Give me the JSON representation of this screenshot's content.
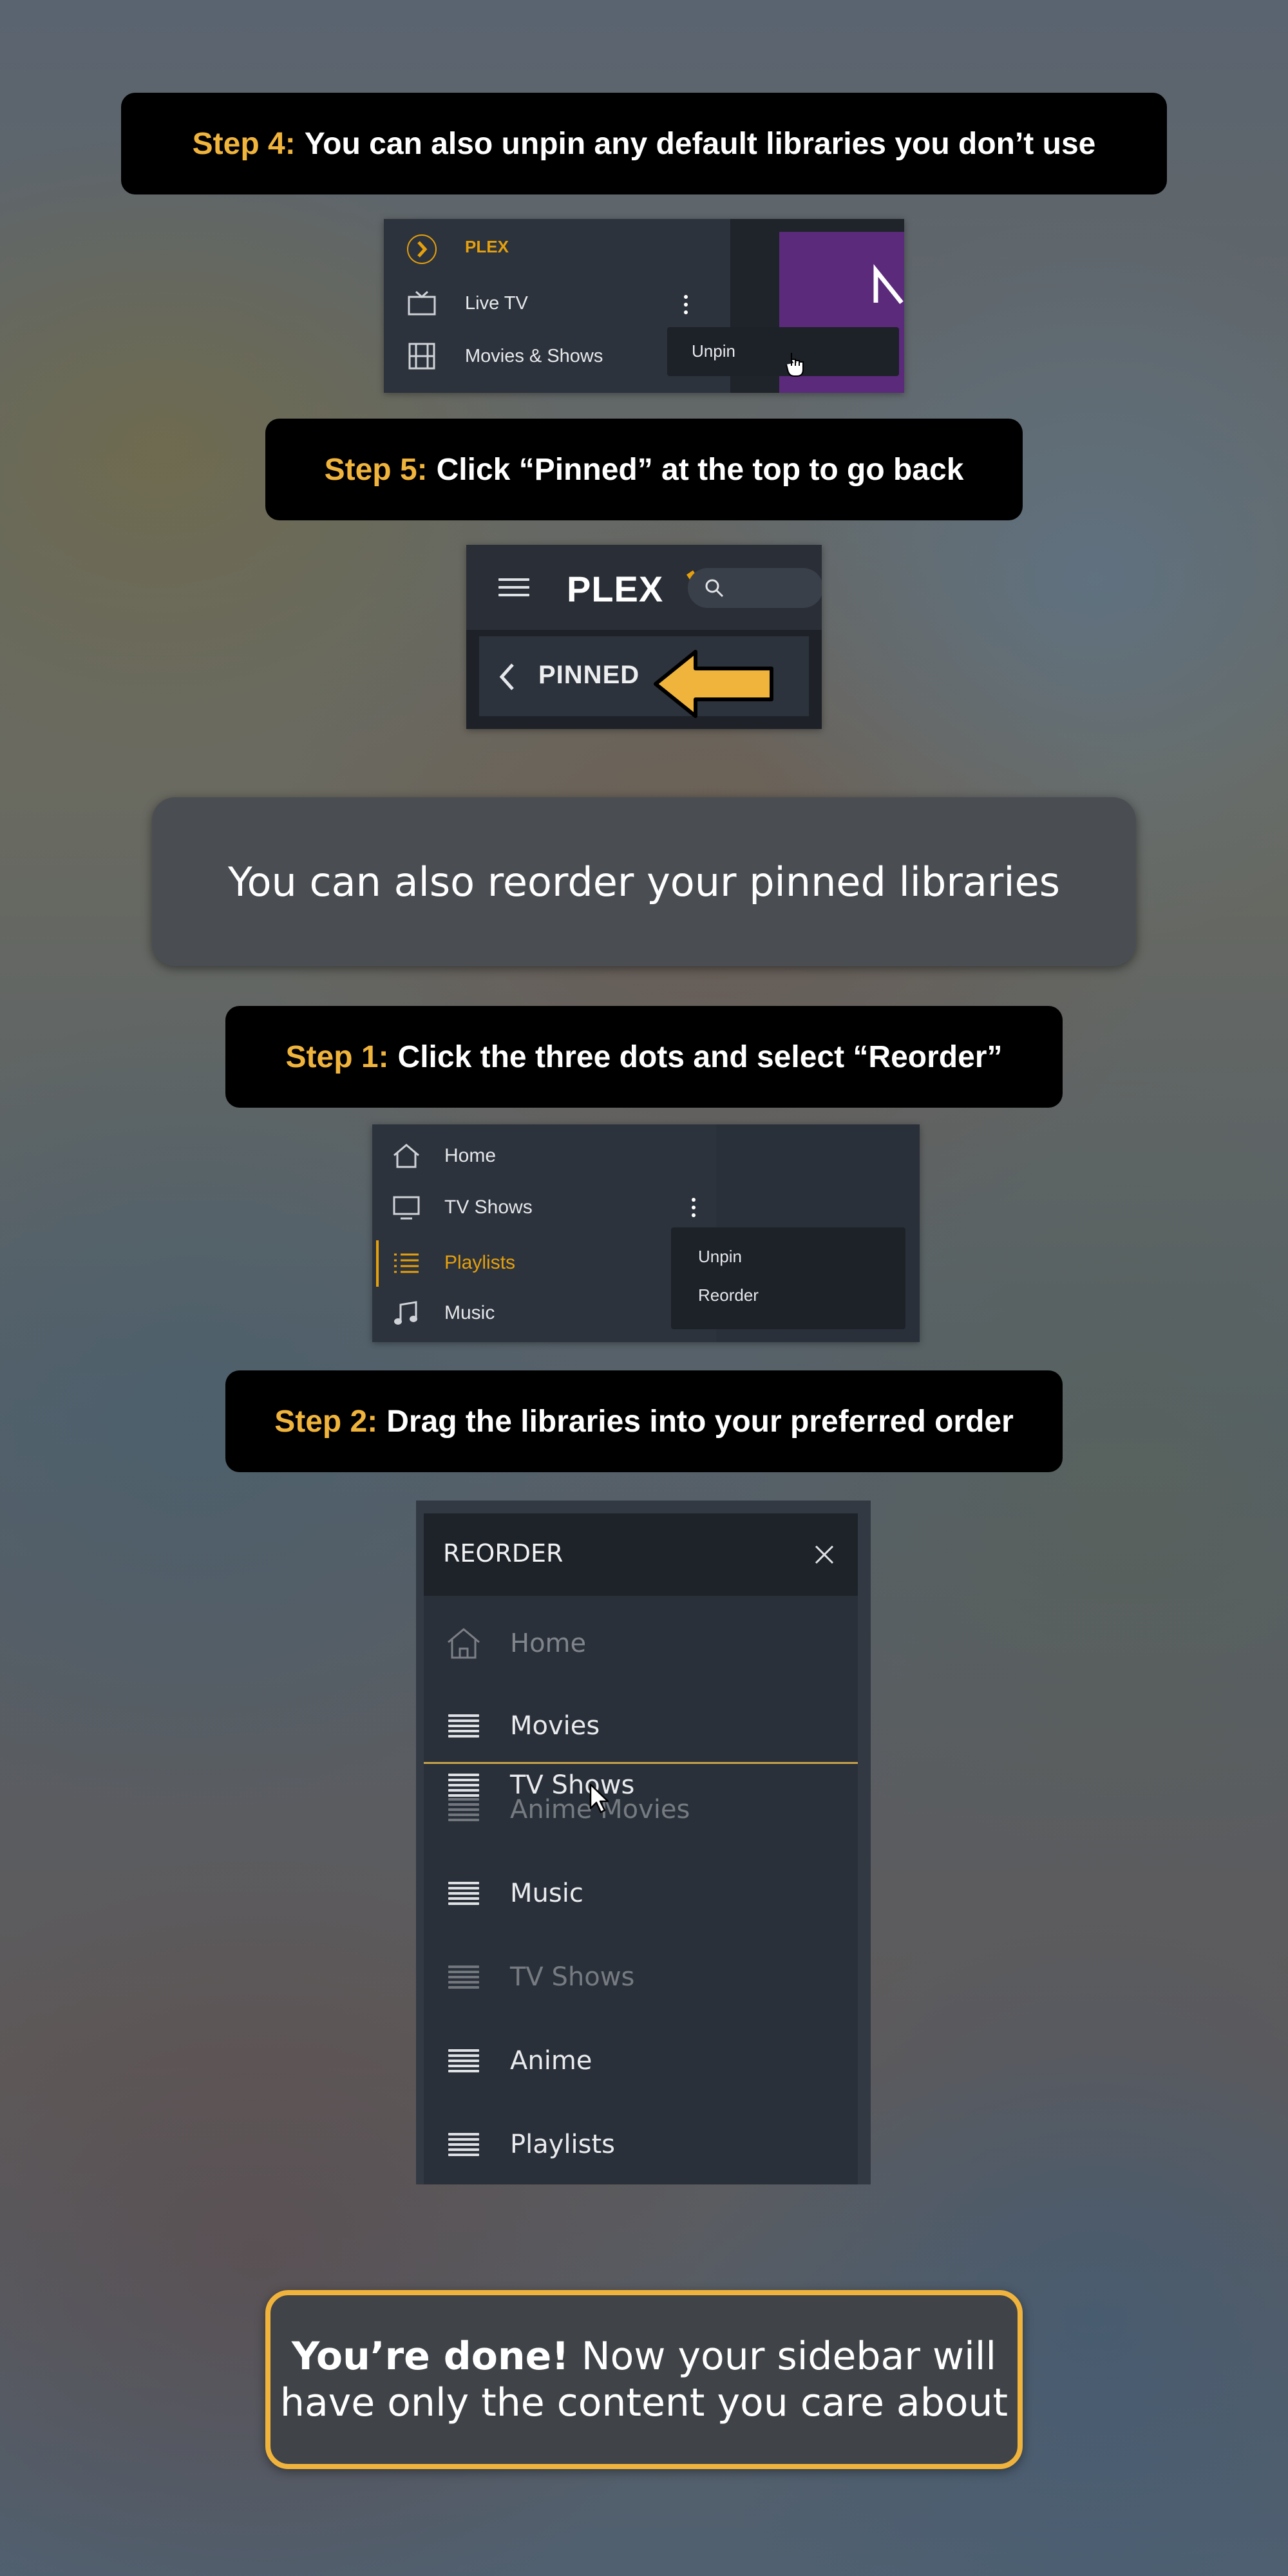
{
  "step4": {
    "label": "Step 4:",
    "text": "You can also unpin any default libraries you don’t use"
  },
  "shot1": {
    "brand": "PLEX",
    "items": [
      {
        "icon": "tv-icon",
        "label": "Live TV"
      },
      {
        "icon": "film-icon",
        "label": "Movies & Shows"
      }
    ],
    "menu": {
      "unpin": "Unpin"
    }
  },
  "step5": {
    "label": "Step 5:",
    "text": "Click “Pinned” at the top to go back"
  },
  "shot2": {
    "logo": "PLEX",
    "pinned": "PINNED"
  },
  "banner": {
    "text": "You can also reorder your pinned libraries"
  },
  "step1": {
    "label": "Step 1:",
    "text": "Click the three dots and select “Reorder”"
  },
  "shot3": {
    "items": [
      {
        "icon": "home-icon",
        "label": "Home"
      },
      {
        "icon": "monitor-icon",
        "label": "TV Shows"
      },
      {
        "icon": "list-icon",
        "label": "Playlists",
        "active": true
      },
      {
        "icon": "music-icon",
        "label": "Music"
      }
    ],
    "menu": {
      "unpin": "Unpin",
      "reorder": "Reorder"
    }
  },
  "step2": {
    "label": "Step 2:",
    "text": "Drag the libraries into your preferred order"
  },
  "reorder": {
    "title": "REORDER",
    "rows": [
      "Home",
      "Movies",
      "Anime Movies",
      "Music",
      "TV Shows",
      "Anime",
      "Playlists"
    ],
    "dragging": "TV Shows"
  },
  "done": {
    "bold": "You’re done!",
    "line1": "Now your sidebar will",
    "line2": "have only the content you care about"
  },
  "colors": {
    "accent": "#f0b43c",
    "panel": "#252b33",
    "plex_orange": "#e5a00d",
    "purple": "#5b2a7a"
  }
}
